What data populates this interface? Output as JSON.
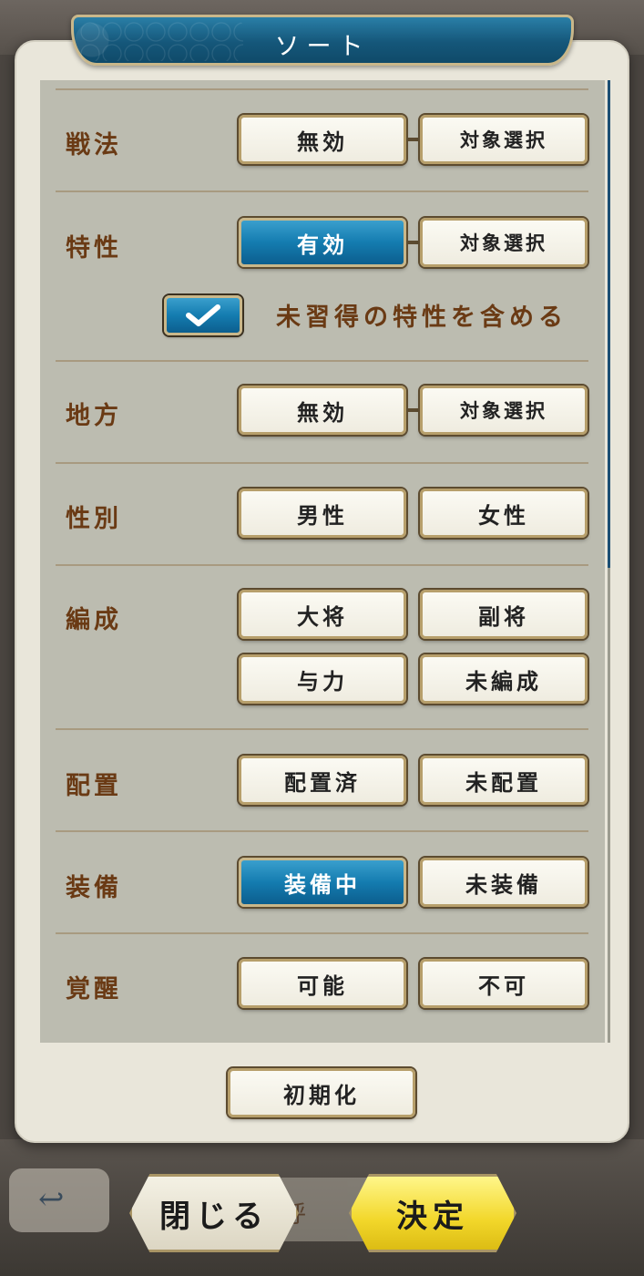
{
  "title": "ソート",
  "rows": [
    {
      "label": "戦法",
      "options": [
        "無効",
        "対象選択"
      ],
      "active": null
    },
    {
      "label": "特性",
      "options": [
        "有効",
        "対象選択"
      ],
      "active": 0
    },
    {
      "label": "地方",
      "options": [
        "無効",
        "対象選択"
      ],
      "active": null
    },
    {
      "label": "性別",
      "options": [
        "男性",
        "女性"
      ],
      "active": null
    },
    {
      "label": "編成",
      "options": [
        "大将",
        "副将",
        "与力",
        "未編成"
      ],
      "active": null
    },
    {
      "label": "配置",
      "options": [
        "配置済",
        "未配置"
      ],
      "active": null
    },
    {
      "label": "装備",
      "options": [
        "装備中",
        "未装備"
      ],
      "active": 0
    },
    {
      "label": "覚醒",
      "options": [
        "可能",
        "不可"
      ],
      "active": null
    }
  ],
  "trait_checkbox": {
    "label": "未習得の特性を含める",
    "checked": true
  },
  "reset_label": "初期化",
  "close_label": "閉じる",
  "decide_label": "決定",
  "background": {
    "back_icon": "↩",
    "ghost_text": "呼"
  },
  "colors": {
    "accent": "#147cb0",
    "label": "#6a3a14",
    "decide": "#f2d72a"
  }
}
